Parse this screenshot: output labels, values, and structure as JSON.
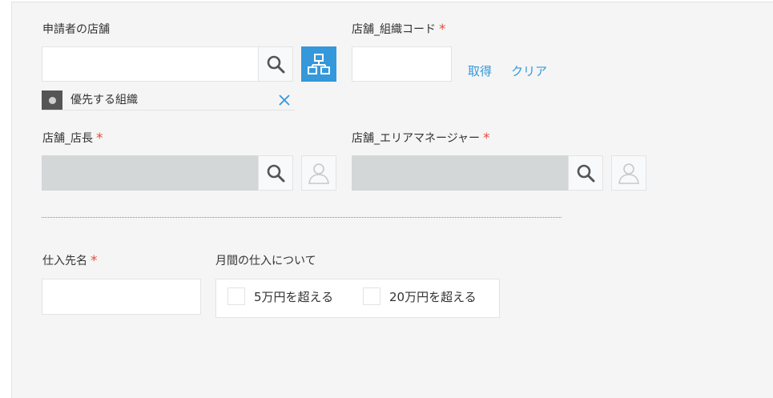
{
  "fields": {
    "applicant_store": {
      "label": "申請者の店舗",
      "value": ""
    },
    "org_chip": {
      "text": "優先する組織"
    },
    "store_org_code": {
      "label": "店舗_組織コード",
      "required": "*",
      "value": ""
    },
    "get_link": "取得",
    "clear_link": "クリア",
    "store_manager": {
      "label": "店舗_店長",
      "required": "*"
    },
    "area_manager": {
      "label": "店舗_エリアマネージャー",
      "required": "*"
    },
    "supplier_name": {
      "label": "仕入先名",
      "required": "*",
      "value": ""
    },
    "monthly_purchase": {
      "label": "月間の仕入について",
      "options": [
        "5万円を超える",
        "20万円を超える"
      ]
    }
  },
  "colors": {
    "accent": "#3498db",
    "required": "#e74c3c",
    "disabled_field": "#d4d7d7"
  },
  "icons": [
    "search-icon",
    "org-tree-icon",
    "user-icon",
    "close-icon"
  ]
}
